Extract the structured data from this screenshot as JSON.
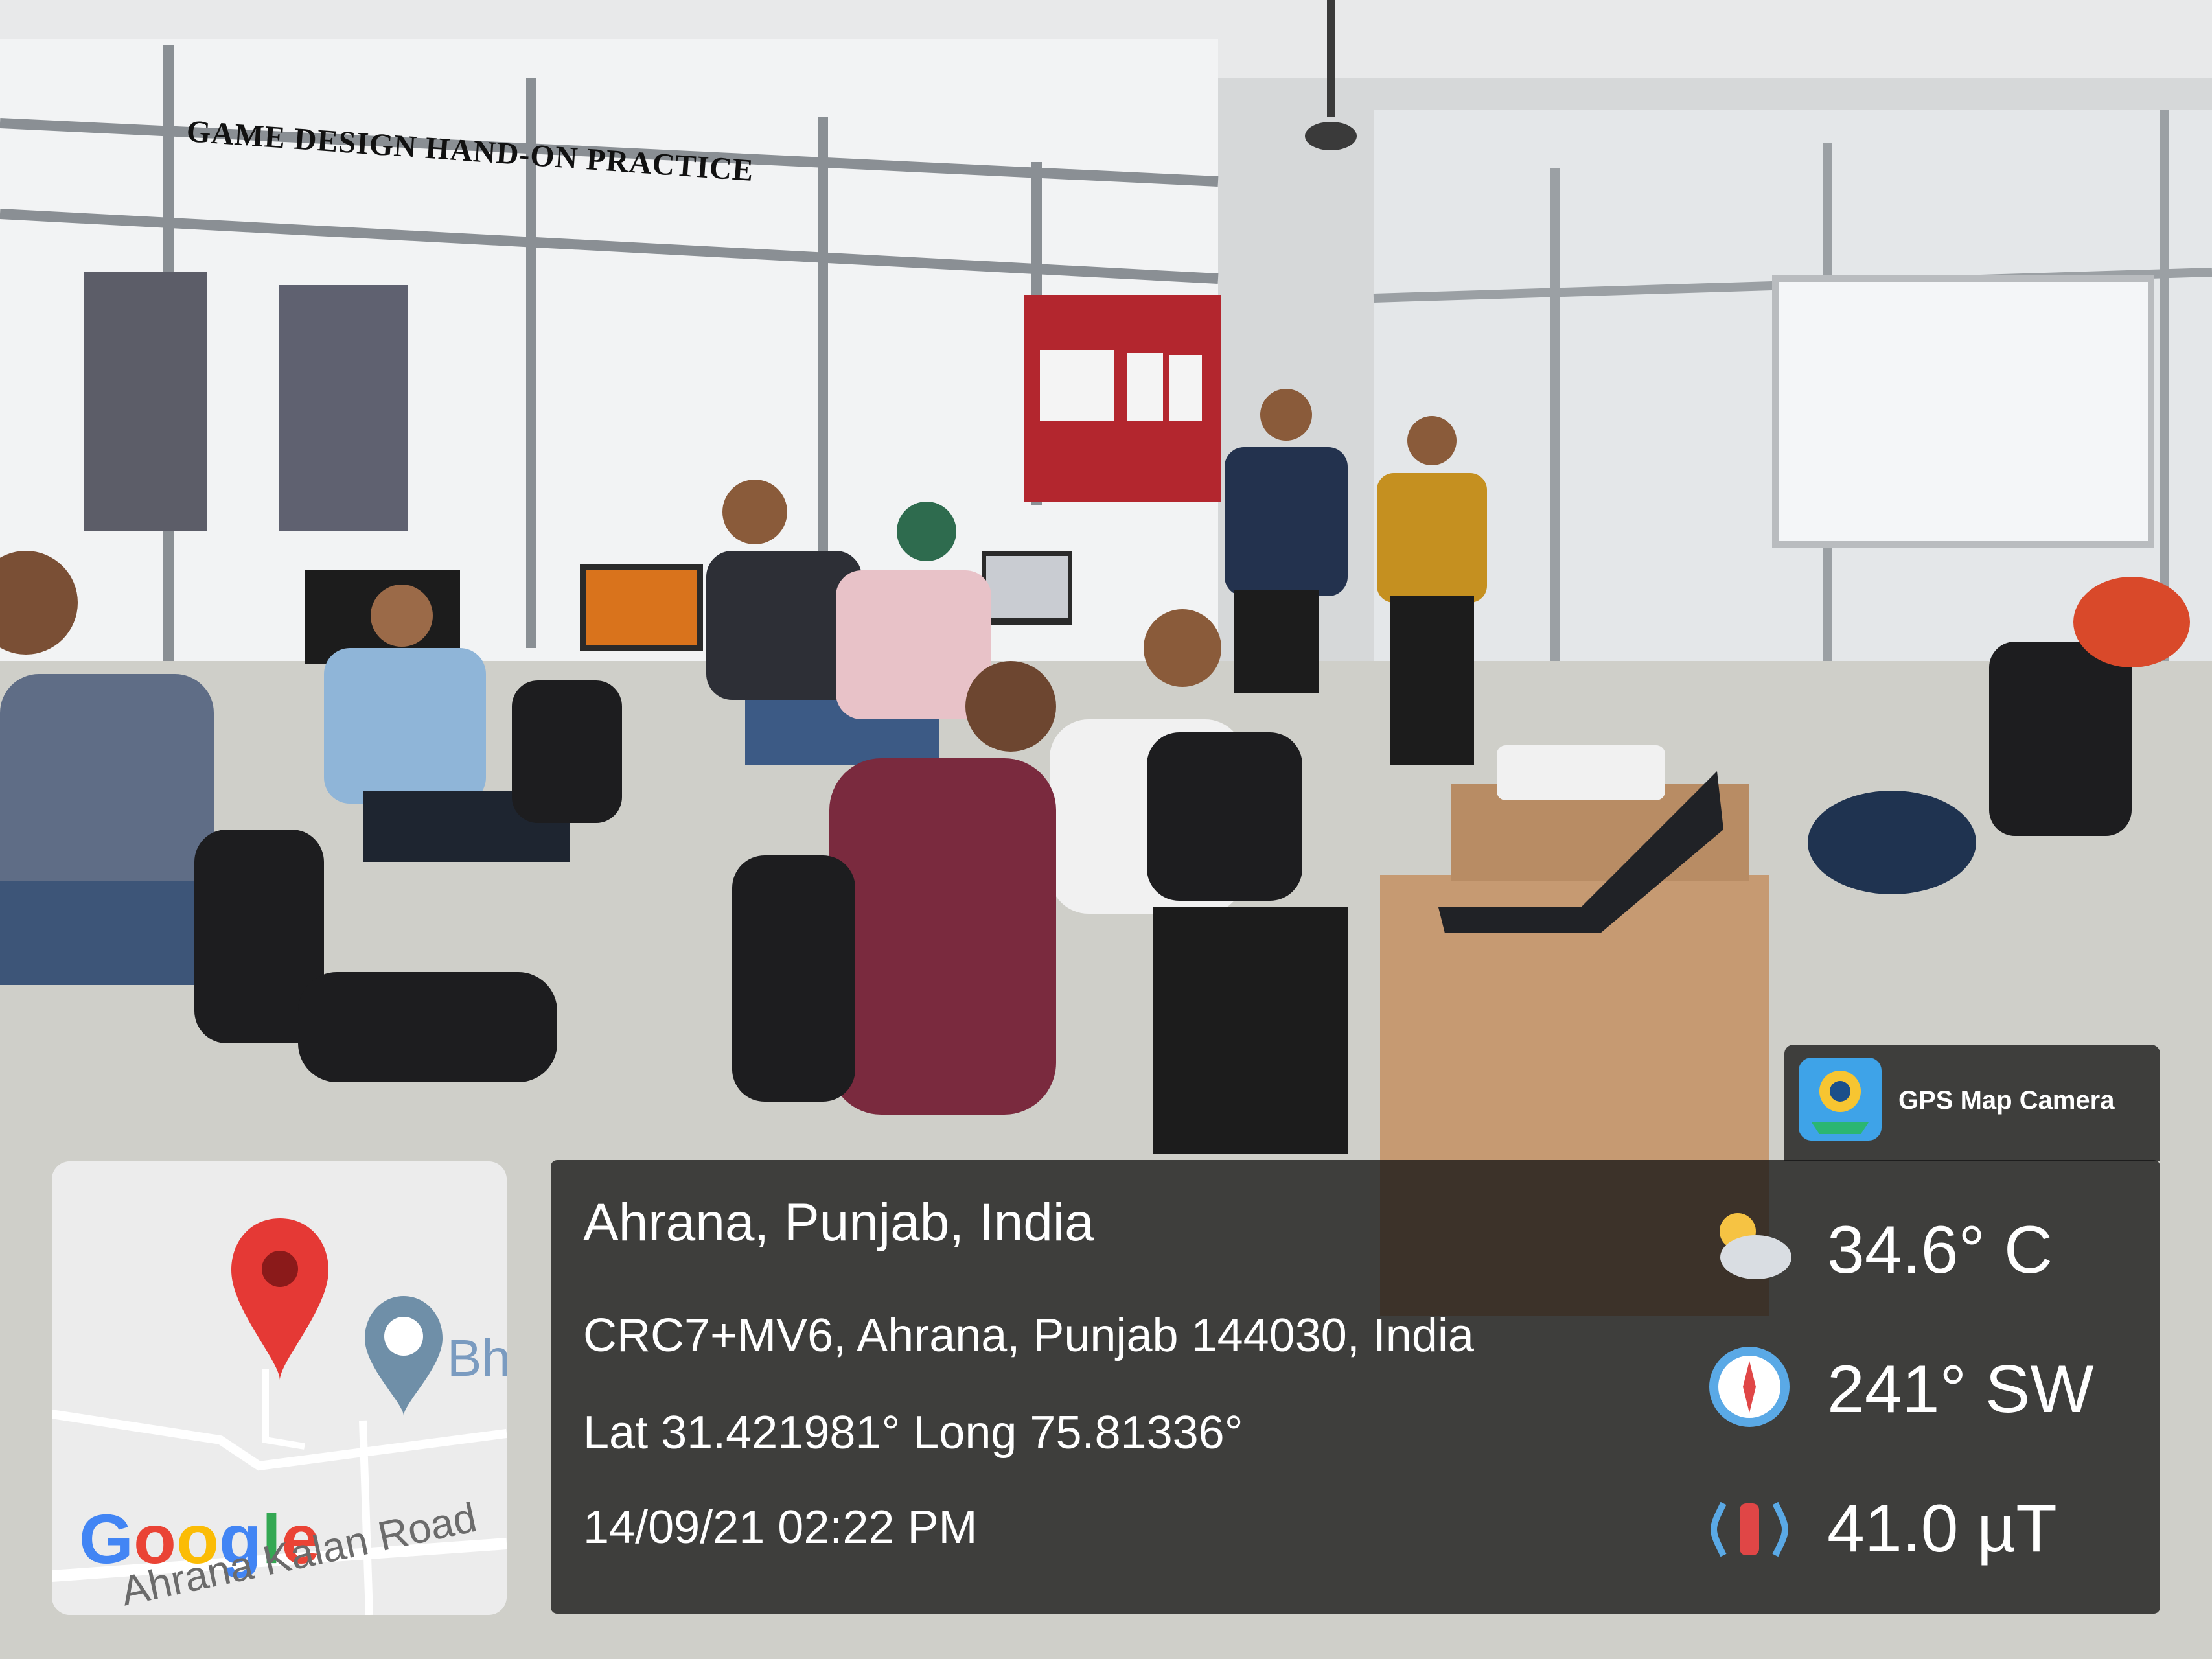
{
  "photo": {
    "caption": "GAME DESIGN HAND-ON PRACTICE"
  },
  "map": {
    "partial_label": "Bh",
    "road_label": "Ahrana Kalan Road",
    "logo_text": "Google",
    "logo_colors": [
      "#4285F4",
      "#EA4335",
      "#FBBC05",
      "#4285F4",
      "#34A853",
      "#EA4335"
    ],
    "pin_color": "#E53935",
    "icons": [
      "map-pin-icon",
      "gurdwara-place-icon"
    ]
  },
  "gps_overlay": {
    "brand_label": "GPS Map Camera",
    "brand_icon": "gps-map-camera-app-icon",
    "place": "Ahrana, Punjab, India",
    "address": "CRC7+MV6, Ahrana, Punjab 144030, India",
    "coordinates": "Lat 31.421981° Long 75.81336°",
    "datetime": "14/09/21 02:22 PM",
    "temperature": "34.6° C",
    "wind": "241° SW",
    "magnetic_field": "41.0 µT",
    "metric_icons": [
      "partly-cloudy-icon",
      "compass-icon",
      "magnet-icon"
    ]
  }
}
